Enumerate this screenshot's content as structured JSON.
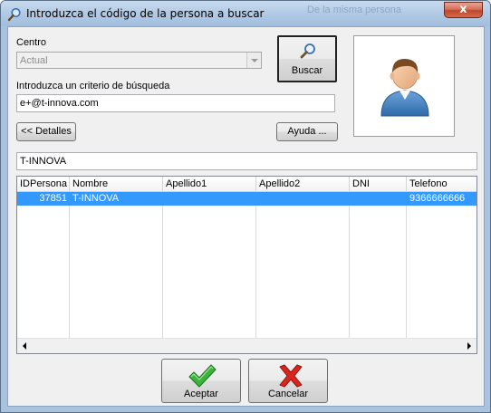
{
  "window": {
    "title": "Introduzca el código de la persona a buscar",
    "background_hint": "De la misma persona",
    "close_label": "x"
  },
  "form": {
    "centro_label": "Centro",
    "centro_value": "Actual",
    "criterio_label": "Introduzca un criterio de búsqueda",
    "criterio_value": "e+@t-innova.com",
    "buscar_label": "Buscar",
    "detalles_label": "<< Detalles",
    "ayuda_label": "Ayuda ...",
    "selected_name": "T-INNOVA"
  },
  "grid": {
    "columns": [
      "IDPersona",
      "Nombre",
      "Apellido1",
      "Apellido2",
      "DNI",
      "Telefono"
    ],
    "rows": [
      {
        "IDPersona": "37851",
        "Nombre": "T-INNOVA",
        "Apellido1": "",
        "Apellido2": "",
        "DNI": "",
        "Telefono": "9366666666"
      }
    ]
  },
  "footer": {
    "aceptar_label": "Aceptar",
    "cancelar_label": "Cancelar"
  },
  "icons": {
    "title": "magnifier-icon",
    "buscar": "magnifier-icon",
    "avatar": "user-avatar-icon",
    "aceptar": "checkmark-icon",
    "cancelar": "red-x-icon"
  },
  "colors": {
    "selection": "#3399ff",
    "ok": "#2ea32e",
    "cancel": "#d42a1e"
  }
}
